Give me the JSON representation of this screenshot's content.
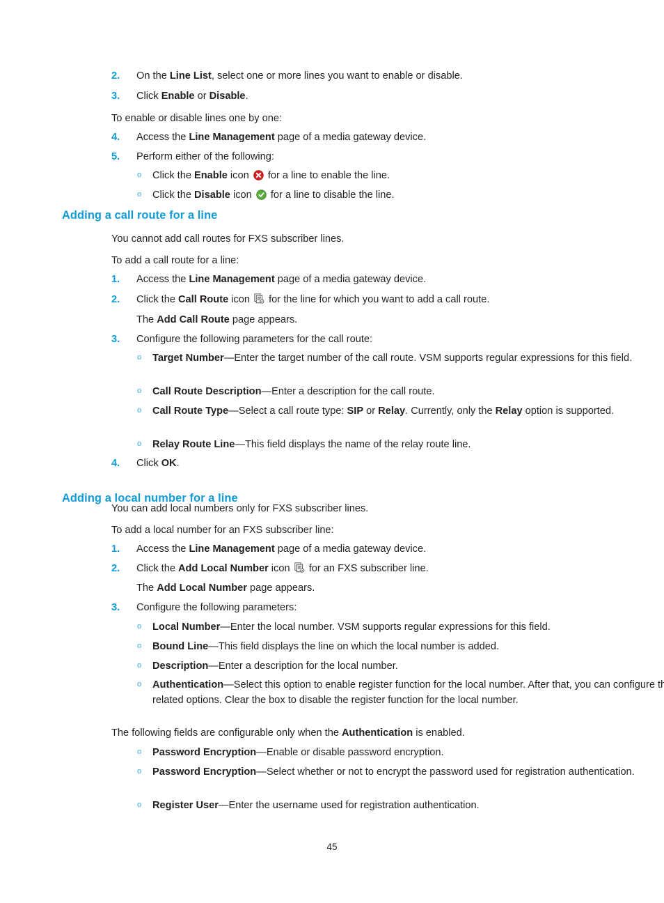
{
  "document": {
    "page_number": "45",
    "heading_color": "#0f9bd7",
    "bullet_color": "#3fa9dd",
    "text_color": "#231f20"
  },
  "blocks": {
    "step2": {
      "num": "2.",
      "pre": "On the ",
      "b1": "Line List",
      "post": ", select one or more lines you want to enable or disable."
    },
    "step3": {
      "num": "3.",
      "pre": "Click ",
      "b1": "Enable",
      "mid": " or ",
      "b2": "Disable",
      "post": "."
    },
    "intro_oneByOne": "To enable or disable lines one by one:",
    "step4": {
      "num": "4.",
      "pre": "Access the ",
      "b1": "Line Management",
      "post": " page of a media gateway device."
    },
    "step5": {
      "num": "5.",
      "text": "Perform either of the following:"
    },
    "bullet_enable": {
      "marker": "o",
      "pre": "Click the ",
      "b1": "Enable",
      "mid": " icon ",
      "icon": "error-red-x-icon",
      "post": " for a line to enable the line."
    },
    "bullet_disable": {
      "marker": "o",
      "pre": "Click the ",
      "b1": "Disable",
      "mid": " icon ",
      "icon": "success-green-check-icon",
      "post": " for a line to disable the line."
    },
    "heading_call_route": "Adding a call route for a line",
    "cr_note": "You cannot add call routes for FXS subscriber lines.",
    "cr_intro": "To add a call route for a line:",
    "cr_step1": {
      "num": "1.",
      "pre": "Access the ",
      "b1": "Line Management",
      "post": " page of a media gateway device."
    },
    "cr_step2": {
      "num": "2.",
      "pre": "Click the ",
      "b1": "Call Route",
      "mid": " icon ",
      "icon": "call-route-pages-icon",
      "post": " for the line for which you want to add a call route."
    },
    "cr_step2_sub": {
      "pre": "The ",
      "b1": "Add Call Route",
      "post": " page appears."
    },
    "cr_step3": {
      "num": "3.",
      "text": "Configure the following parameters for the call route:"
    },
    "cr_b1": {
      "marker": "o",
      "b1": "Target Number",
      "post": "—Enter the target number of the call route. VSM supports regular expressions for this field."
    },
    "cr_b2": {
      "marker": "o",
      "b1": "Call Route Description",
      "post": "—Enter a description for the call route."
    },
    "cr_b3": {
      "marker": "o",
      "b1": "Call Route Type",
      "t1": "—Select a call route type: ",
      "b2": "SIP",
      "t2": " or ",
      "b3": "Relay",
      "t3": ". Currently, only the ",
      "b4": "Relay",
      "t4": " option is supported."
    },
    "cr_b4": {
      "marker": "o",
      "b1": "Relay Route Line",
      "post": "—This field displays the name of the relay route line."
    },
    "cr_step4": {
      "num": "4.",
      "pre": "Click ",
      "b1": "OK",
      "post": "."
    },
    "heading_local_number": "Adding a local number for a line",
    "ln_note": "You can add local numbers only for FXS subscriber lines.",
    "ln_intro": "To add a local number for an FXS subscriber line:",
    "ln_step1": {
      "num": "1.",
      "pre": "Access the ",
      "b1": "Line Management",
      "post": " page of a media gateway device."
    },
    "ln_step2": {
      "num": "2.",
      "pre": "Click the ",
      "b1": "Add Local Number",
      "mid": " icon ",
      "icon": "add-local-number-pages-icon",
      "post": " for an FXS subscriber line."
    },
    "ln_step2_sub": {
      "pre": "The ",
      "b1": "Add Local Number",
      "post": " page appears."
    },
    "ln_step3": {
      "num": "3.",
      "text": "Configure the following parameters:"
    },
    "ln_b1": {
      "marker": "o",
      "b1": "Local Number",
      "post": "—Enter the local number. VSM supports regular expressions for this field."
    },
    "ln_b2": {
      "marker": "o",
      "b1": "Bound Line",
      "post": "—This field displays the line on which the local number is added."
    },
    "ln_b3": {
      "marker": "o",
      "b1": "Description",
      "post": "—Enter a description for the local number."
    },
    "ln_b4": {
      "marker": "o",
      "b1": "Authentication",
      "post": "—Select this option to enable register function for the local number. After that, you can configure the authentication related options. Clear the box to disable the register function for the local number."
    },
    "ln_auth_note": {
      "pre": "The following fields are configurable only when the ",
      "b1": "Authentication",
      "post": " is enabled."
    },
    "ln_b5": {
      "marker": "o",
      "b1": "Password Encryption",
      "post": "—Enable or disable password encryption."
    },
    "ln_b6": {
      "marker": "o",
      "b1": "Password Encryption",
      "post": "—Select whether or not to encrypt the password used for registration authentication."
    },
    "ln_b7": {
      "marker": "o",
      "b1": "Register User",
      "post": "—Enter the username used for registration authentication."
    }
  }
}
